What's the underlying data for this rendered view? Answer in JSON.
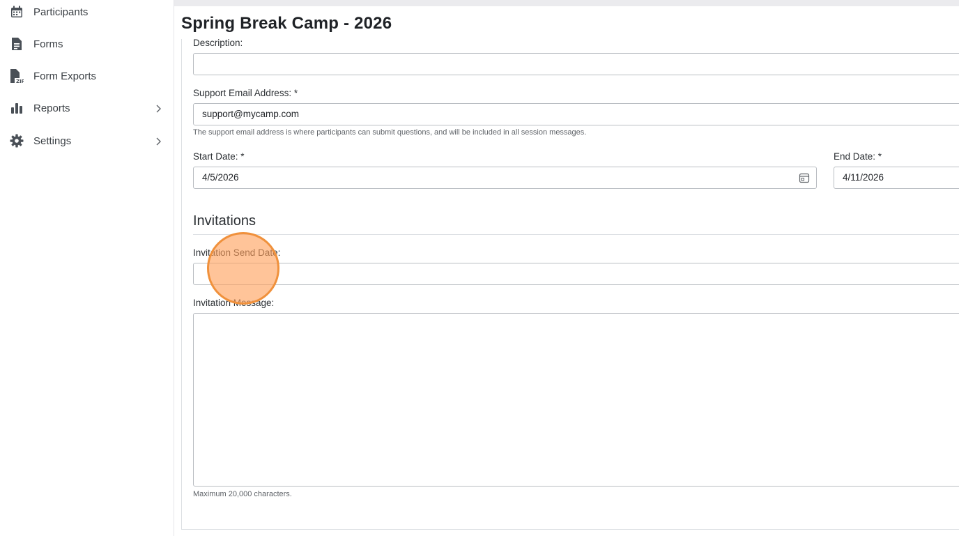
{
  "sidebar": {
    "items": [
      {
        "label": "Participants",
        "icon": "calendar-icon",
        "has_submenu": false
      },
      {
        "label": "Forms",
        "icon": "document-icon",
        "has_submenu": false
      },
      {
        "label": "Form Exports",
        "icon": "zip-file-icon",
        "has_submenu": false
      },
      {
        "label": "Reports",
        "icon": "bar-chart-icon",
        "has_submenu": true
      },
      {
        "label": "Settings",
        "icon": "gear-icon",
        "has_submenu": true
      }
    ]
  },
  "page": {
    "title": "Spring Break Camp - 2026"
  },
  "form": {
    "description": {
      "label": "Description:",
      "value": ""
    },
    "support_email": {
      "label": "Support Email Address: *",
      "value": "support@mycamp.com",
      "help": "The support email address is where participants can submit questions, and will be included in all session messages."
    },
    "start_date": {
      "label": "Start Date: *",
      "value": "4/5/2026"
    },
    "end_date": {
      "label": "End Date: *",
      "value": "4/11/2026"
    },
    "invitations": {
      "heading": "Invitations",
      "send_date": {
        "label": "Invitation Send Date:",
        "value": ""
      },
      "message": {
        "label": "Invitation Message:",
        "value": "",
        "help": "Maximum 20,000 characters."
      }
    }
  },
  "colors": {
    "accent_cursor": "#f0913c",
    "border": "#b9bdc2",
    "icon": "#4a5057"
  }
}
